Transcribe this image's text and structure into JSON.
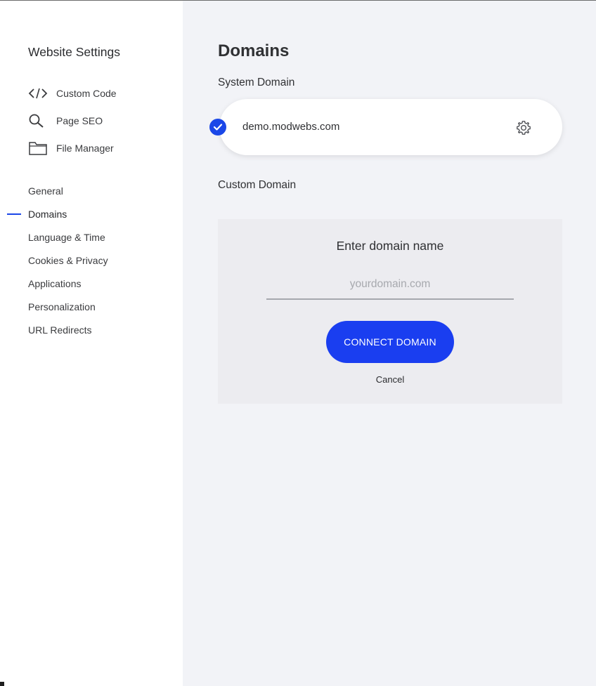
{
  "sidebar": {
    "title": "Website Settings",
    "tools": [
      {
        "label": "Custom Code",
        "icon": "code-icon"
      },
      {
        "label": "Page SEO",
        "icon": "search-icon"
      },
      {
        "label": "File Manager",
        "icon": "folder-icon"
      }
    ],
    "nav": [
      {
        "label": "General",
        "active": false
      },
      {
        "label": "Domains",
        "active": true
      },
      {
        "label": "Language & Time",
        "active": false
      },
      {
        "label": "Cookies & Privacy",
        "active": false
      },
      {
        "label": "Applications",
        "active": false
      },
      {
        "label": "Personalization",
        "active": false
      },
      {
        "label": "URL Redirects",
        "active": false
      }
    ]
  },
  "main": {
    "title": "Domains",
    "system_domain": {
      "label": "System Domain",
      "domain": "demo.modwebs.com",
      "status_icon": "check-circle-icon",
      "settings_icon": "gear-icon"
    },
    "custom_domain": {
      "label": "Custom Domain",
      "prompt": "Enter domain name",
      "input_value": "",
      "input_placeholder": "yourdomain.com",
      "connect_label": "CONNECT DOMAIN",
      "cancel_label": "Cancel"
    }
  },
  "colors": {
    "accent": "#1a47e8",
    "button": "#1a3ef0",
    "main_bg": "#f2f3f7",
    "panel_bg": "#ececf0"
  }
}
